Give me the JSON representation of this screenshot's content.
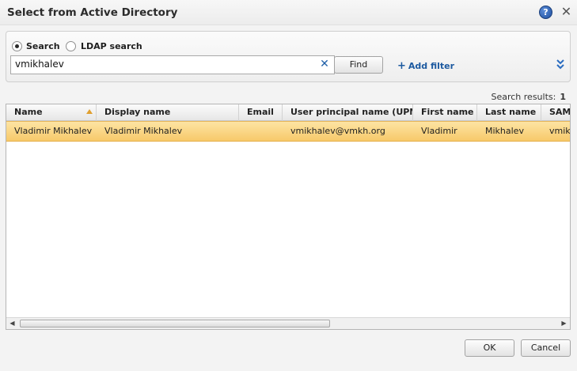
{
  "dialog": {
    "title": "Select from Active Directory",
    "help_icon": "help-icon",
    "help_glyph": "?",
    "close_icon": "close-icon",
    "close_glyph": "✕"
  },
  "search": {
    "mode_options": [
      {
        "label": "Search",
        "checked": true
      },
      {
        "label": "LDAP search",
        "checked": false
      }
    ],
    "query_value": "vmikhalev",
    "clear_glyph": "✕",
    "find_label": "Find",
    "add_filter_label": "Add filter",
    "add_filter_glyph": "+",
    "expand_glyph": "⌄⌄"
  },
  "results": {
    "label": "Search results:",
    "count": "1"
  },
  "grid": {
    "columns": [
      "Name",
      "Display name",
      "Email",
      "User principal name (UPN)",
      "First name",
      "Last name",
      "SAM"
    ],
    "sorted_column": "Name",
    "rows": [
      [
        "Vladimir Mikhalev",
        "Vladimir Mikhalev",
        "",
        "vmikhalev@vmkh.org",
        "Vladimir",
        "Mikhalev",
        "vmikh"
      ]
    ],
    "scroll_left_glyph": "◀",
    "scroll_right_glyph": "▶"
  },
  "footer": {
    "ok_label": "OK",
    "cancel_label": "Cancel"
  },
  "colors": {
    "selected_row": "#f9d27d",
    "link_blue": "#1d5aa0",
    "sort_arrow": "#e0a030"
  }
}
